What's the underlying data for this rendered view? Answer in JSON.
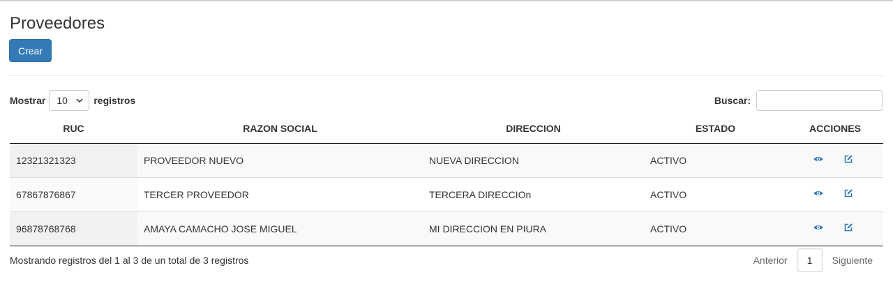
{
  "page": {
    "title": "Proveedores"
  },
  "toolbar": {
    "create_label": "Crear"
  },
  "length": {
    "label_before": "Mostrar",
    "selected": "10",
    "label_after": "registros"
  },
  "search": {
    "label": "Buscar:",
    "value": "",
    "placeholder": ""
  },
  "table": {
    "columns": [
      "RUC",
      "RAZON SOCIAL",
      "DIRECCION",
      "ESTADO",
      "ACCIONES"
    ],
    "rows": [
      {
        "ruc": "12321321323",
        "razon_social": "PROVEEDOR NUEVO",
        "direccion": "NUEVA DIRECCION",
        "estado": "ACTIVO"
      },
      {
        "ruc": "67867876867",
        "razon_social": "TERCER PROVEEDOR",
        "direccion": "TERCERA DIRECCIOn",
        "estado": "ACTIVO"
      },
      {
        "ruc": "96878768768",
        "razon_social": "AMAYA CAMACHO JOSE MIGUEL",
        "direccion": "MI DIRECCION EN PIURA",
        "estado": "ACTIVO"
      }
    ],
    "actions": {
      "view_icon": "eye-icon",
      "edit_icon": "edit-icon"
    }
  },
  "footer": {
    "info": "Mostrando registros del 1 al 3 de un total de 3 registros",
    "prev_label": "Anterior",
    "current_page": "1",
    "next_label": "Siguiente"
  },
  "colors": {
    "primary": "#337ab7",
    "icon": "#337ab7"
  }
}
